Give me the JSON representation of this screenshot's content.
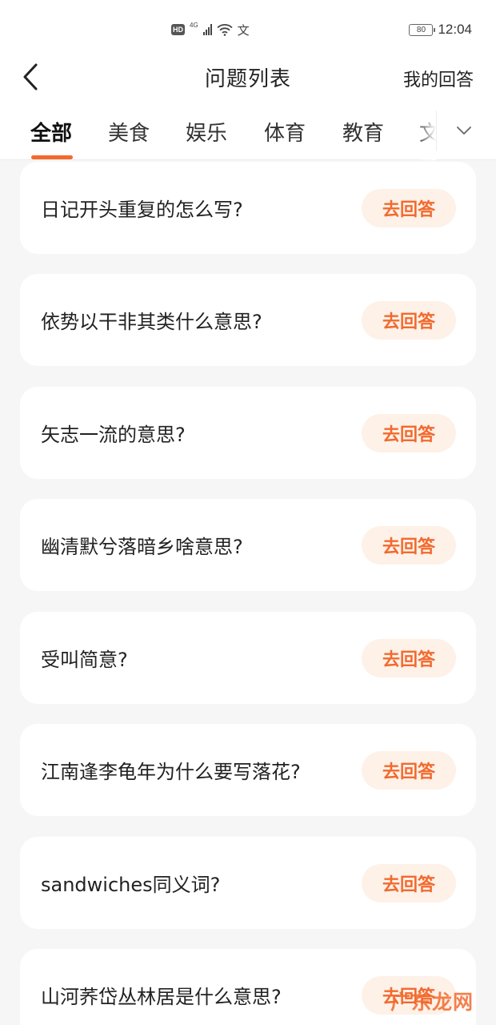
{
  "status_bar": {
    "hd": "HD",
    "network": "4G",
    "vpn": "文",
    "battery": "80",
    "time": "12:04"
  },
  "nav": {
    "title": "问题列表",
    "right_action": "我的回答"
  },
  "tabs": [
    {
      "label": "全部",
      "active": true
    },
    {
      "label": "美食"
    },
    {
      "label": "娱乐"
    },
    {
      "label": "体育"
    },
    {
      "label": "教育"
    },
    {
      "label": "文"
    }
  ],
  "accent_color": "#f26a2e",
  "questions": [
    {
      "text": "日记开头重复的怎么写?",
      "button": "去回答"
    },
    {
      "text": "依势以干非其类什么意思?",
      "button": "去回答"
    },
    {
      "text": "矢志一流的意思?",
      "button": "去回答"
    },
    {
      "text": "幽清默兮落暗乡啥意思?",
      "button": "去回答"
    },
    {
      "text": "受叫简意?",
      "button": "去回答"
    },
    {
      "text": "江南逢李龟年为什么要写落花?",
      "button": "去回答"
    },
    {
      "text": "sandwiches同义词?",
      "button": "去回答"
    },
    {
      "text": "山河荞岱丛林居是什么意思?",
      "button": "去回答"
    }
  ],
  "watermark": "广东龙网"
}
